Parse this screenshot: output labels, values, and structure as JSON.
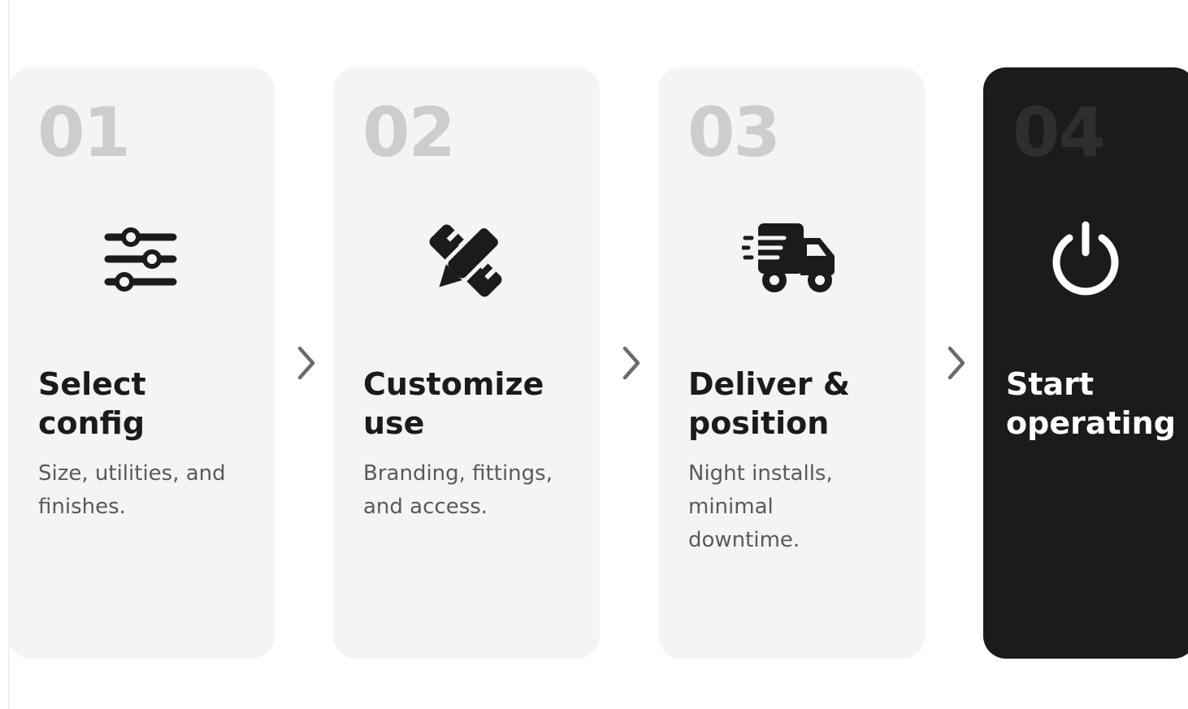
{
  "colors": {
    "card_background": "#f4f4f4",
    "card_dark_background": "#1b1b1b",
    "number_color": "#cdcdcd",
    "number_dark_color": "#2e2e2e",
    "title_color": "#1b1b1b",
    "description_color": "#5a5a5a",
    "chevron_color": "#6b6b6b"
  },
  "steps": [
    {
      "number": "01",
      "icon": "sliders-icon",
      "title": "Select\nconfig",
      "description": "Size, utilities, and\nfinishes."
    },
    {
      "number": "02",
      "icon": "pencil-ruler-icon",
      "title": "Customize\nuse",
      "description": "Branding, fittings,\nand access."
    },
    {
      "number": "03",
      "icon": "delivery-truck-icon",
      "title": "Deliver &\nposition",
      "description": "Night installs,\nminimal\ndowntime."
    },
    {
      "number": "04",
      "icon": "power-icon",
      "title": "Start\noperating",
      "description": "",
      "active": true
    }
  ],
  "connectors": [
    "chevron-right-icon",
    "chevron-right-icon",
    "chevron-right-icon"
  ]
}
